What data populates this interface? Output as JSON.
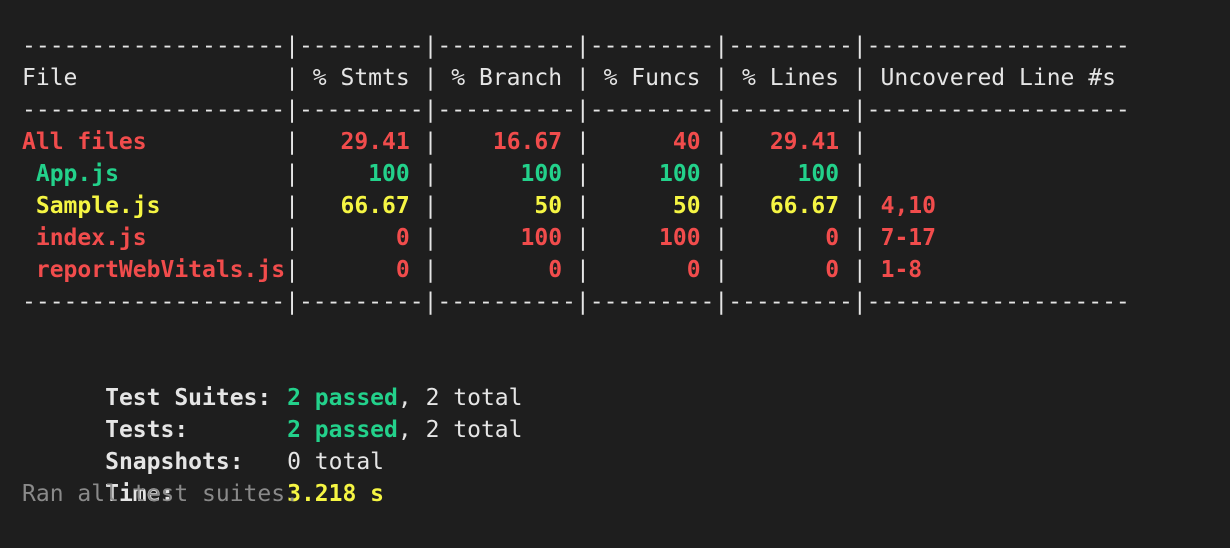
{
  "colors": {
    "background": "#1e1e1e",
    "text": "#e5e5e5",
    "red": "#f14c4c",
    "green": "#23d18b",
    "yellow": "#f5f543",
    "dim": "#8a8a8a"
  },
  "coverage": {
    "separator": "-------------------|---------|----------|---------|---------|-------------------",
    "header": "File               | % Stmts | % Branch | % Funcs | % Lines | Uncovered Line #s ",
    "rows": [
      {
        "file": "All files",
        "stmts": "29.41",
        "branch": "16.67",
        "funcs": "40",
        "lines": "29.41",
        "uncovered": "",
        "color": "red"
      },
      {
        "file": " App.js",
        "stmts": "100",
        "branch": "100",
        "funcs": "100",
        "lines": "100",
        "uncovered": "",
        "color": "green"
      },
      {
        "file": " Sample.js",
        "stmts": "66.67",
        "branch": "50",
        "funcs": "50",
        "lines": "66.67",
        "uncovered": "4,10",
        "color": "yellow"
      },
      {
        "file": " index.js",
        "stmts": "0",
        "branch": "100",
        "funcs": "100",
        "lines": "0",
        "uncovered": "7-17",
        "color": "red"
      },
      {
        "file": " reportWebVitals.js",
        "stmts": "0",
        "branch": "0",
        "funcs": "0",
        "lines": "0",
        "uncovered": "1-8",
        "color": "red"
      }
    ]
  },
  "summary": {
    "test_suites": {
      "label": "Test Suites:",
      "passed": "2 passed",
      "rest": ", 2 total"
    },
    "tests": {
      "label": "Tests:",
      "passed": "2 passed",
      "rest": ", 2 total"
    },
    "snapshots": {
      "label": "Snapshots:",
      "value": "0 total"
    },
    "time": {
      "label": "Time:",
      "value": "3.218 s"
    },
    "footer": "Ran all test suites."
  }
}
